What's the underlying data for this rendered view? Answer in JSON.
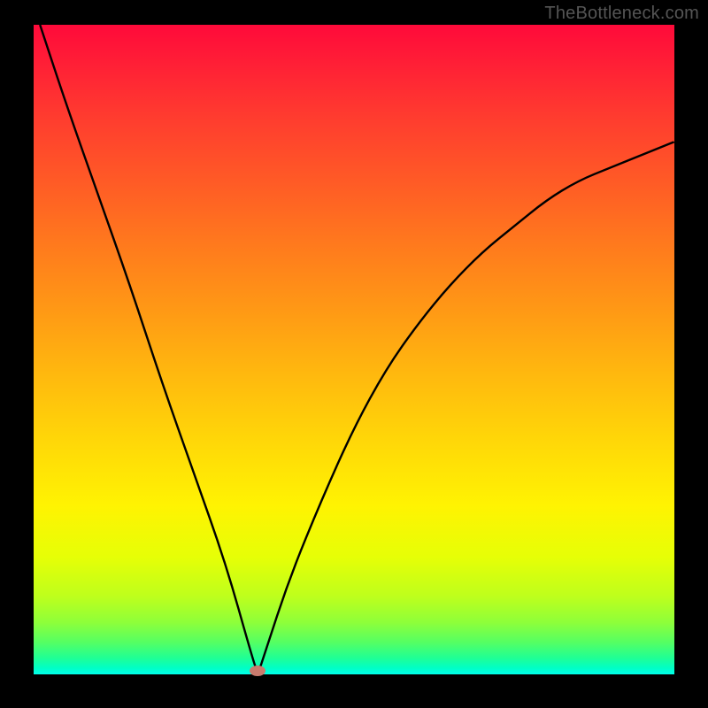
{
  "watermark": "TheBottleneck.com",
  "chart_data": {
    "type": "line",
    "title": "",
    "xlabel": "",
    "ylabel": "",
    "xlim": [
      0,
      100
    ],
    "ylim": [
      0,
      100
    ],
    "background_gradient": {
      "top_color": "#ff0a3a",
      "bottom_color": "#00ffea",
      "description": "vertical rainbow gradient from red (high bottleneck) to green/cyan (low bottleneck)"
    },
    "series": [
      {
        "name": "bottleneck-curve",
        "color": "#000000",
        "x": [
          1,
          5,
          10,
          15,
          20,
          25,
          30,
          34,
          35,
          36,
          40,
          45,
          50,
          55,
          60,
          65,
          70,
          75,
          80,
          85,
          90,
          95,
          100
        ],
        "values": [
          100,
          88,
          74,
          60,
          45,
          31,
          17,
          3,
          0,
          3,
          15,
          27,
          38,
          47,
          54,
          60,
          65,
          69,
          73,
          76,
          78,
          80,
          82
        ]
      }
    ],
    "marker": {
      "name": "optimal-point",
      "color": "#c97b6e",
      "x": 35,
      "y": 0.5
    }
  }
}
